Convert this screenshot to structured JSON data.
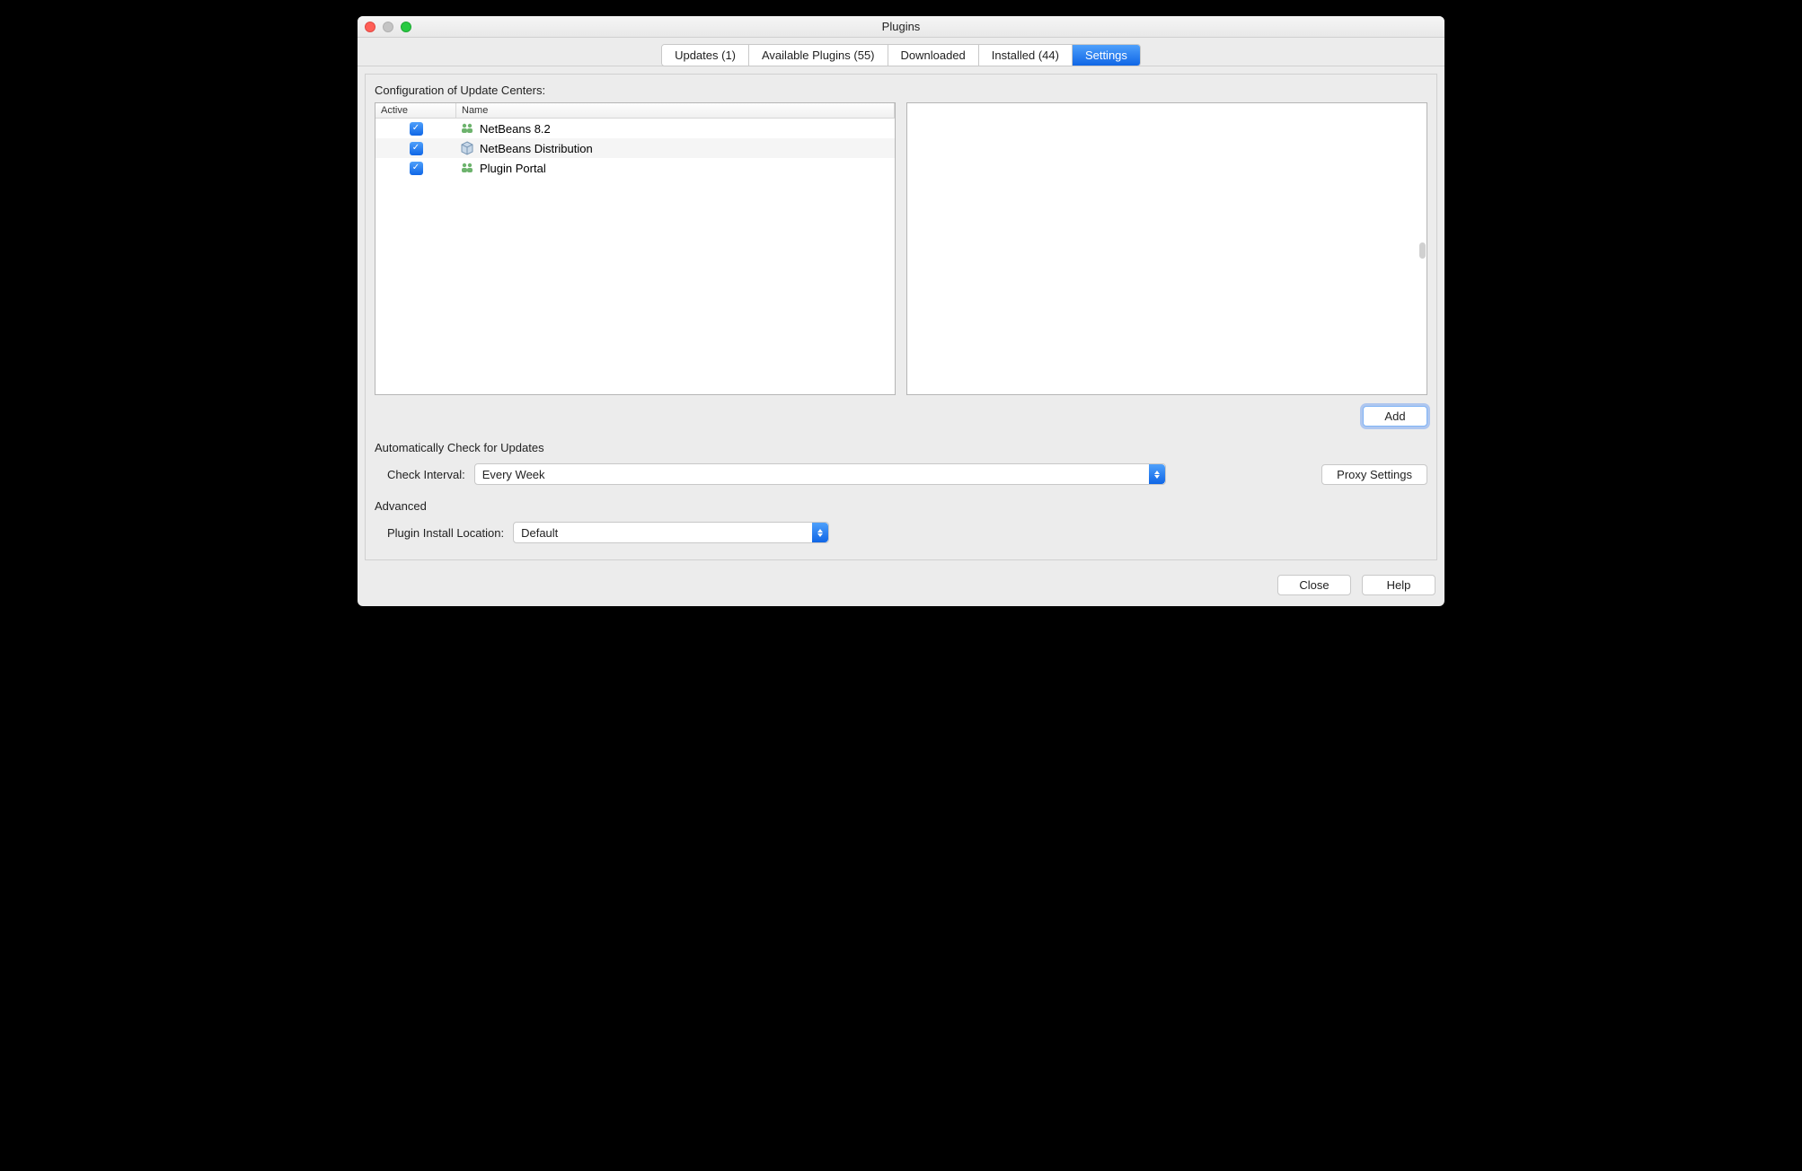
{
  "window": {
    "title": "Plugins"
  },
  "tabs": [
    {
      "label": "Updates (1)"
    },
    {
      "label": "Available Plugins (55)"
    },
    {
      "label": "Downloaded"
    },
    {
      "label": "Installed (44)"
    },
    {
      "label": "Settings"
    }
  ],
  "section": {
    "title": "Configuration of Update Centers:",
    "columns": {
      "active": "Active",
      "name": "Name"
    },
    "rows": [
      {
        "active": true,
        "icon": "people-icon",
        "name": "NetBeans 8.2"
      },
      {
        "active": true,
        "icon": "cube-icon",
        "name": "NetBeans Distribution"
      },
      {
        "active": true,
        "icon": "people-icon",
        "name": "Plugin Portal"
      }
    ]
  },
  "buttons": {
    "add": "Add",
    "proxy": "Proxy Settings",
    "close": "Close",
    "help": "Help"
  },
  "auto_check": {
    "title": "Automatically Check for Updates",
    "interval_label": "Check Interval:",
    "interval_value": "Every Week"
  },
  "advanced": {
    "title": "Advanced",
    "location_label": "Plugin Install Location:",
    "location_value": "Default"
  }
}
